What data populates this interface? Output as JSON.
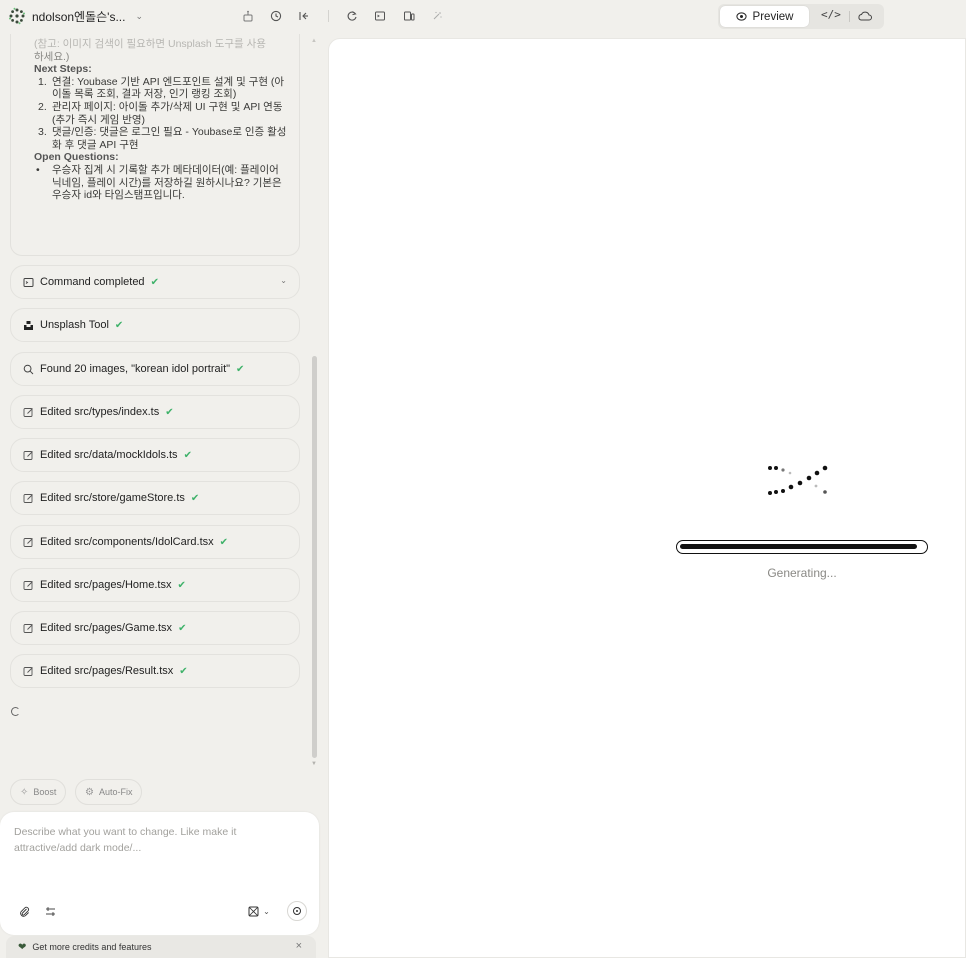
{
  "header": {
    "project_name": "ndolson엔돌슨's...",
    "view_toggle": {
      "preview_label": "Preview",
      "code_label": "</>"
    },
    "icons": [
      "bot-icon",
      "history-icon",
      "collapse-panel-icon",
      "refresh-icon",
      "terminal-icon",
      "device-icon",
      "magic-select-icon"
    ]
  },
  "summary": {
    "faded_line_1": "(참고: 이미지 검색이 필요하면 Unsplash 도구를 사용",
    "faded_line_2": "하세요.)",
    "next_steps_heading": "Next Steps:",
    "next_steps": [
      {
        "num": "1.",
        "text": "연결: Youbase 기반 API 엔드포인트 설계 및 구현 (아이돌 목록 조회, 결과 저장, 인기 랭킹 조회)"
      },
      {
        "num": "2.",
        "text": "관리자 페이지: 아이돌 추가/삭제 UI 구현 및 API 연동 (추가 즉시 게임 반영)"
      },
      {
        "num": "3.",
        "text": "댓글/인증: 댓글은 로그인 필요 - Youbase로 인증 활성화 후 댓글 API 구현"
      }
    ],
    "open_questions_heading": "Open Questions:",
    "open_questions": [
      "우승자 집계 시 기록할 추가 메타데이터(예: 플레이어 닉네임, 플레이 시간)를 저장하길 원하시나요? 기본은 우승자 id와 타임스탬프입니다."
    ]
  },
  "steps": [
    {
      "icon": "terminal-icon",
      "label": "Command completed",
      "expandable": true
    },
    {
      "icon": "unsplash-icon",
      "label": "Unsplash Tool"
    },
    {
      "icon": "search-icon",
      "label": "Found 20 images, \"korean idol portrait\""
    },
    {
      "icon": "edit-icon",
      "label": "Edited src/types/index.ts"
    },
    {
      "icon": "edit-icon",
      "label": "Edited src/data/mockIdols.ts"
    },
    {
      "icon": "edit-icon",
      "label": "Edited src/store/gameStore.ts"
    },
    {
      "icon": "edit-icon",
      "label": "Edited src/components/IdolCard.tsx"
    },
    {
      "icon": "edit-icon",
      "label": "Edited src/pages/Home.tsx"
    },
    {
      "icon": "edit-icon",
      "label": "Edited src/pages/Game.tsx"
    },
    {
      "icon": "edit-icon",
      "label": "Edited src/pages/Result.tsx"
    }
  ],
  "chips": {
    "boost": "Boost",
    "autofix": "Auto-Fix"
  },
  "composer": {
    "placeholder": "Describe what you want to change. Like make it attractive/add dark mode/..."
  },
  "credits": {
    "text": "Get more credits and features",
    "close": "×"
  },
  "preview": {
    "status": "Generating...",
    "progress": 0.97
  },
  "colors": {
    "check": "#3fb26a",
    "background": "#f1f0ec",
    "preview_bg": "#ffffff"
  }
}
